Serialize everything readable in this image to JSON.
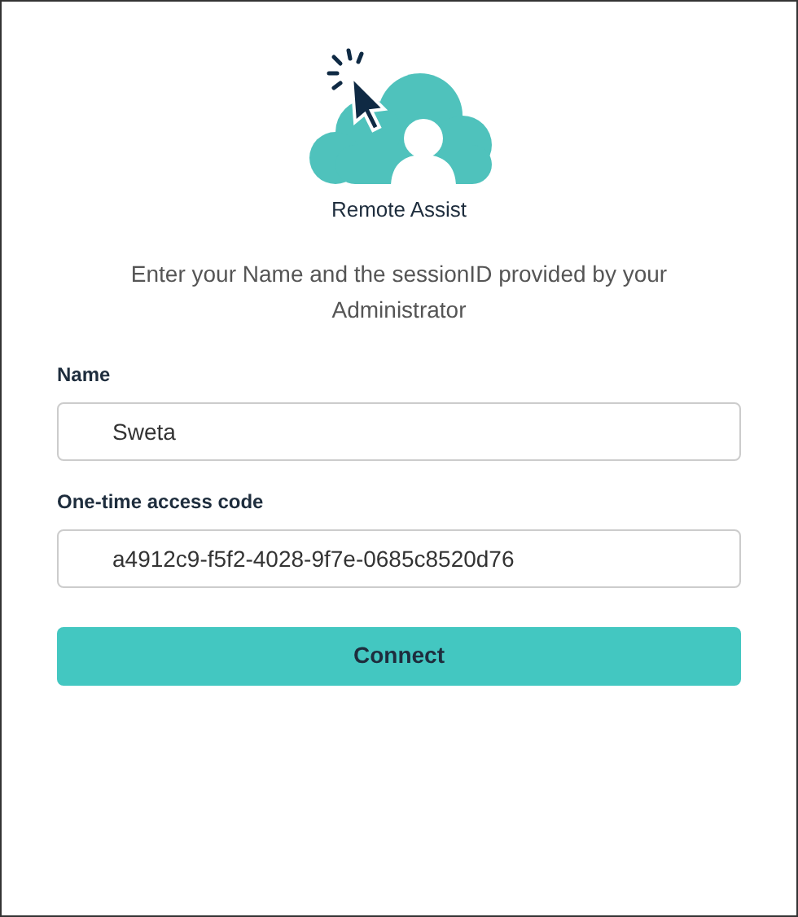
{
  "app_name": "Remote Assist",
  "instructions": "Enter your Name and the sessionID provided by your Administrator",
  "fields": [
    {
      "label": "Name",
      "value": "Sweta"
    },
    {
      "label": "One-time access code",
      "value": "a4912c9-f5f2-4028-9f7e-0685c8520d76"
    }
  ],
  "button": "Connect"
}
